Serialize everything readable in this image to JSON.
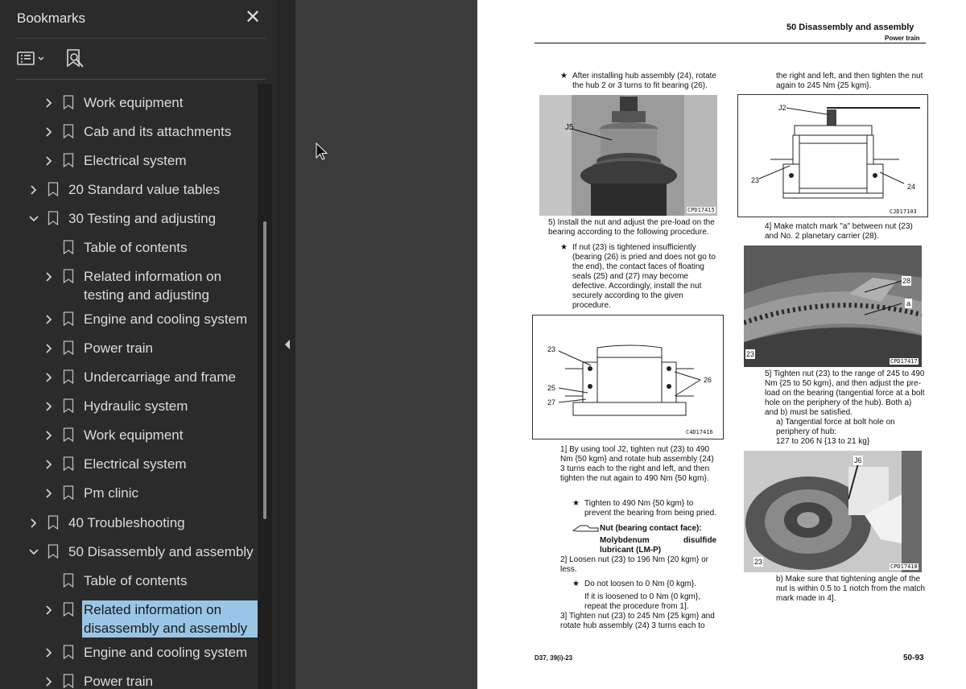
{
  "sidebar": {
    "title": "Bookmarks",
    "close_icon": "close-icon",
    "items": [
      {
        "label": "Work equipment",
        "level": 2,
        "expand": "collapsed"
      },
      {
        "label": "Cab and its attachments",
        "level": 2,
        "expand": "collapsed"
      },
      {
        "label": "Electrical system",
        "level": 2,
        "expand": "collapsed"
      },
      {
        "label": "20 Standard value tables",
        "level": 1,
        "expand": "collapsed"
      },
      {
        "label": "30 Testing and adjusting",
        "level": 1,
        "expand": "expanded"
      },
      {
        "label": "Table of contents",
        "level": 2,
        "expand": "none"
      },
      {
        "label": "Related information on testing and adjusting",
        "level": 2,
        "expand": "collapsed"
      },
      {
        "label": "Engine and cooling system",
        "level": 2,
        "expand": "collapsed"
      },
      {
        "label": "Power train",
        "level": 2,
        "expand": "collapsed"
      },
      {
        "label": "Undercarriage and frame",
        "level": 2,
        "expand": "collapsed"
      },
      {
        "label": "Hydraulic system",
        "level": 2,
        "expand": "collapsed"
      },
      {
        "label": "Work equipment",
        "level": 2,
        "expand": "collapsed"
      },
      {
        "label": "Electrical system",
        "level": 2,
        "expand": "collapsed"
      },
      {
        "label": "Pm clinic",
        "level": 2,
        "expand": "collapsed"
      },
      {
        "label": "40 Troubleshooting",
        "level": 1,
        "expand": "collapsed"
      },
      {
        "label": "50 Disassembly and assembly",
        "level": 1,
        "expand": "expanded"
      },
      {
        "label": "Table of contents",
        "level": 2,
        "expand": "none"
      },
      {
        "label": "Related information on disassembly and assembly",
        "level": 2,
        "expand": "collapsed",
        "selected": true
      },
      {
        "label": "Engine and cooling system",
        "level": 2,
        "expand": "collapsed"
      },
      {
        "label": "Power train",
        "level": 2,
        "expand": "collapsed"
      }
    ]
  },
  "document": {
    "header_title": "50 Disassembly and assembly",
    "header_sub": "Power train",
    "left_col": {
      "note1": "After installing hub assembly (24), rotate the hub 2 or 3 turns to fit bearing (26).",
      "fig1_label": "J5",
      "fig1_code": "CPD17415",
      "step5": "5)  Install the nut and adjust the pre-load on the bearing according to the following procedure.",
      "note2": "If nut (23) is tightened insufficiently (bearing (26) is pried and does not go to the end), the contact faces of floating seals (25) and (27) may become defective. Accordingly, install the nut securely according to the given procedure.",
      "fig2_labels": [
        "23",
        "25",
        "27",
        "26"
      ],
      "fig2_code": "C4D17416",
      "sub1": "1]  By using tool J2, tighten nut (23) to 490 Nm {50 kgm} and rotate hub assembly (24) 3 turns each to the right and left, and then tighten the nut again to 490 Nm {50 kgm}.",
      "note3": "Tighten to 490 Nm {50 kgm} to prevent the bearing from being pried.",
      "lube_title": "Nut (bearing contact face):",
      "lube_name_a": "Molybdenum",
      "lube_name_b": "disulfide",
      "lube_name_c": "lubricant (LM-P)",
      "sub2": "2]  Loosen nut (23) to 196 Nm {20 kgm} or less.",
      "note4": "Do not loosen to 0 Nm {0 kgm}.",
      "note4b": "If it is loosened to 0 Nm {0 kgm}, repeat the procedure from 1].",
      "sub3": "3]  Tighten nut (23) to 245 Nm {25 kgm} and rotate hub assembly (24) 3 turns each to"
    },
    "right_col": {
      "cont": "the right and left, and then tighten the nut again to 245 Nm {25 kgm}.",
      "fig3_labels": [
        "J2",
        "23",
        "24"
      ],
      "fig3_code": "CJD17103",
      "sub4": "4]  Make match mark \"a\" between nut (23) and No. 2 planetary carrier (28).",
      "fig4_labels": [
        "28",
        "a",
        "23"
      ],
      "fig4_code": "CPD17417",
      "sub5": "5]  Tighten nut (23) to the range of 245 to 490 Nm {25 to 50 kgm}, and then adjust the pre-load on the bearing (tangential force at a bolt hole on the periphery of the hub). Both a) and b) must be satisfied.",
      "sub5a": "a)  Tangential force at bolt hole on periphery of hub:",
      "sub5a_val": "127 to 206 N {13 to 21 kg}",
      "fig5_labels": [
        "J6",
        "23"
      ],
      "fig5_code": "CPD17418",
      "sub5b": "b)  Make sure that tightening angle of the nut is within 0.5 to 1 notch from the match mark made in 4]."
    },
    "footer_left": "D37, 39(i)-23",
    "footer_right": "50-93"
  }
}
